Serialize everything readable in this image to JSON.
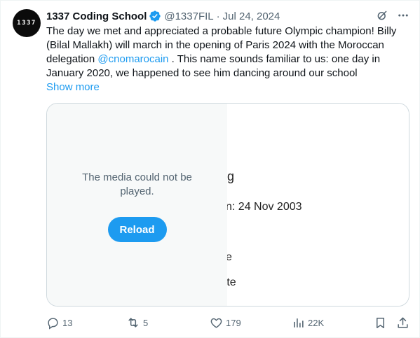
{
  "tweet": {
    "avatar_text": "1337",
    "author_name": "1337 Coding School",
    "handle": "@1337FIL",
    "separator": "·",
    "date": "Jul 24, 2024",
    "text_part1": "The day we met and appreciated a probable future Olympic champion! Billy (Bilal Mallakh) will march in the opening of Paris 2024 with the Moroccan delegation ",
    "mention": "@cnomarocain",
    "text_part2": " . This name sounds familiar to us: one day in January 2020, we happened to see him dancing around our school",
    "show_more": "Show more"
  },
  "media": {
    "error_message": "The media could not be played.",
    "reload_label": "Reload",
    "frame_fragments": {
      "line1": "g",
      "line2": "n:  24 Nov 2003",
      "line3": "e",
      "line4": "hlete"
    }
  },
  "actions": {
    "replies": "13",
    "reposts": "5",
    "likes": "179",
    "views": "22K"
  },
  "colors": {
    "accent": "#1d9bf0",
    "muted": "#536471",
    "text": "#0f1419"
  }
}
